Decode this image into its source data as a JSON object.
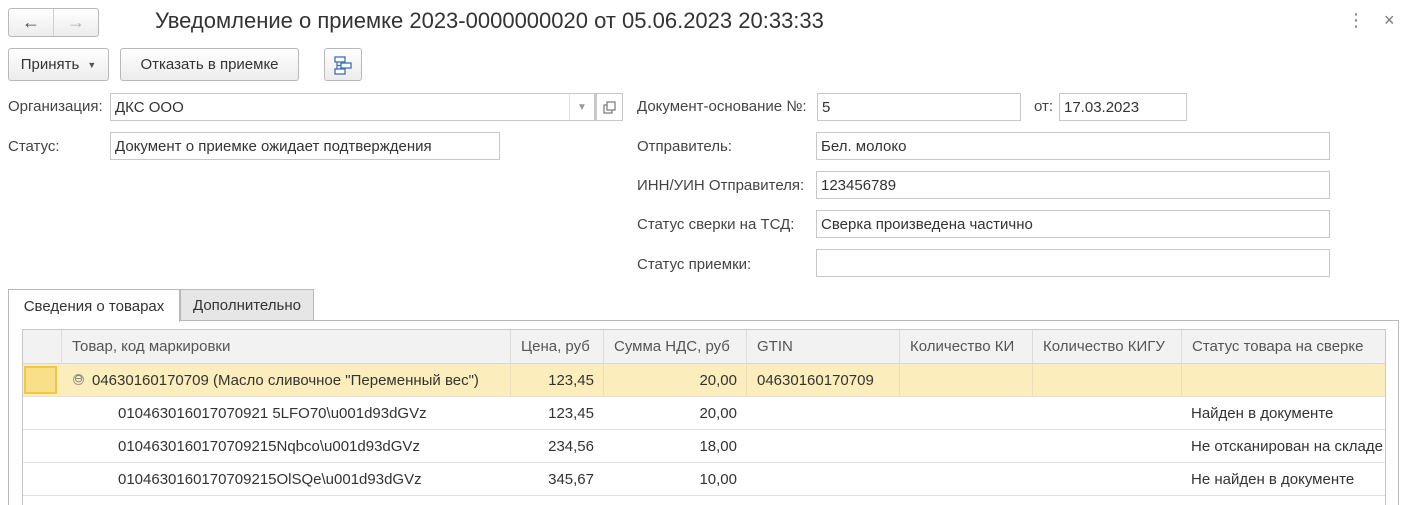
{
  "window": {
    "title": "Уведомление о приемке 2023-0000000020 от 05.06.2023 20:33:33",
    "back_icon": "←",
    "forward_icon": "→",
    "more_icon": "⋮",
    "close_icon": "×"
  },
  "toolbar": {
    "accept_label": "Принять",
    "accept_caret": "▼",
    "reject_label": "Отказать в приемке"
  },
  "form": {
    "organization_label": "Организация:",
    "organization_value": "ДКС ООО",
    "status_label": "Статус:",
    "status_value": "Документ о приемке ожидает подтверждения",
    "base_doc_label": "Документ-основание №:",
    "base_doc_value": "5",
    "date_label": "от:",
    "date_value": "17.03.2023",
    "sender_label": "Отправитель:",
    "sender_value": "Бел. молоко",
    "inn_label": "ИНН/УИН Отправителя:",
    "inn_value": "123456789",
    "tsd_status_label": "Статус сверки на ТСД:",
    "tsd_status_value": "Сверка произведена частично",
    "acceptance_status_label": "Статус приемки:",
    "acceptance_status_value": ""
  },
  "tabs": [
    {
      "label": "Сведения о товарах",
      "active": true
    },
    {
      "label": "Дополнительно",
      "active": false
    }
  ],
  "table": {
    "columns": [
      "Товар, код маркировки",
      "Цена, руб",
      "Сумма НДС, руб",
      "GTIN",
      "Количество КИ",
      "Количество КИГУ",
      "Статус товара на сверке"
    ],
    "group_row": {
      "toggle": "⊖",
      "product": "04630160170709 (Масло сливочное \"Переменный вес\")",
      "price": "123,45",
      "vat": "20,00",
      "gtin": "04630160170709",
      "ki": "",
      "kigu": "",
      "status": ""
    },
    "rows": [
      {
        "product": "010463016017070921 5LFO70\\u001d93dGVz",
        "price": "123,45",
        "vat": "20,00",
        "gtin": "",
        "ki": "",
        "kigu": "",
        "status": "Найден в документе"
      },
      {
        "product": "0104630160170709215Nqbco\\u001d93dGVz",
        "price": "234,56",
        "vat": "18,00",
        "gtin": "",
        "ki": "",
        "kigu": "",
        "status": "Не отсканирован на складе"
      },
      {
        "product": "0104630160170709215OlSQe\\u001d93dGVz",
        "price": "345,67",
        "vat": "10,00",
        "gtin": "",
        "ki": "",
        "kigu": "",
        "status": "Не найден в документе"
      }
    ]
  }
}
